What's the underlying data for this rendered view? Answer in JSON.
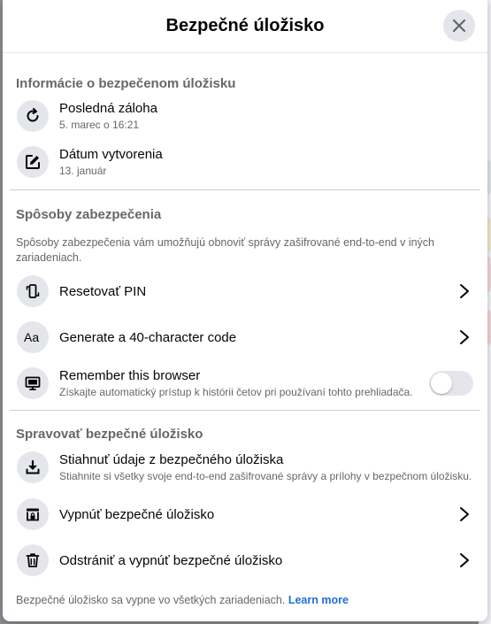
{
  "dialog": {
    "title": "Bezpečné úložisko"
  },
  "info_section": {
    "title": "Informácie o bezpečenom úložisku",
    "items": [
      {
        "label": "Posledná záloha",
        "sub": "5. marec o 16:21",
        "icon": "refresh-icon"
      },
      {
        "label": "Dátum vytvorenia",
        "sub": "13. január",
        "icon": "edit-icon"
      }
    ]
  },
  "security_section": {
    "title": "Spôsoby zabezpečenia",
    "description": "Spôsoby zabezpečenia vám umožňujú obnoviť správy zašifrované end-to-end v iných zariadeniach.",
    "items": [
      {
        "label": "Resetovať PIN",
        "icon": "phone-sync-icon"
      },
      {
        "label": "Generate a 40-character code",
        "icon": "text-aa-icon"
      },
      {
        "label": "Remember this browser",
        "sub": "Získajte automatický prístup k histórii četov pri používaní tohto prehliadača.",
        "icon": "monitor-icon",
        "toggle_on": false
      }
    ]
  },
  "manage_section": {
    "title": "Spravovať bezpečné úložisko",
    "items": [
      {
        "label": "Stiahnuť údaje z bezpečného úložiska",
        "sub": "Stiahnite si všetky svoje end-to-end zašifrované správy a prílohy v bezpečnom úložisku.",
        "icon": "download-icon"
      },
      {
        "label": "Vypnúť bezpečné úložisko",
        "icon": "storage-lock-icon"
      },
      {
        "label": "Odstrániť a vypnúť bezpečné úložisko",
        "icon": "trash-icon"
      }
    ]
  },
  "footer": {
    "text": "Bezpečné úložisko sa vypne vo všetkých zariadeniach.",
    "link": "Learn more"
  },
  "colors": {
    "link": "#216fdb",
    "secondary_text": "#65676b",
    "icon_bg": "#e4e6eb"
  }
}
